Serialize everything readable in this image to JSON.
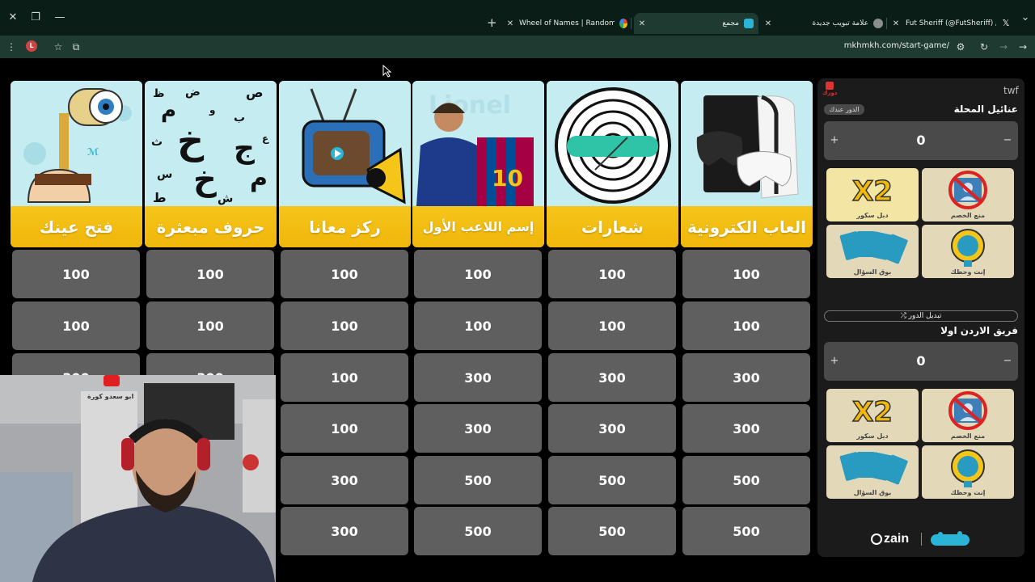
{
  "browser": {
    "tabs": [
      {
        "title": "Wheel of Names | Random nam",
        "fav_color": "#4285f4"
      },
      {
        "title": "مجمع",
        "fav_color": "#2ab5d6"
      },
      {
        "title": "علامة تبويب جديدة",
        "fav_color": "#aaaaaa"
      },
      {
        "title": "Fut Sheriff (@FutSheriff) / X",
        "fav_color": "#000000"
      }
    ],
    "profile_initial": "L",
    "url": "mkhmkh.com/start-game/"
  },
  "board": {
    "categories": [
      {
        "title": "العاب الكترونية"
      },
      {
        "title": "شعارات"
      },
      {
        "title": "إسم اللاعب الأول"
      },
      {
        "title": "ركز معانا"
      },
      {
        "title": "حروف مبعثرة"
      },
      {
        "title": "فتح عينك"
      }
    ],
    "columns": [
      [
        "100",
        "100",
        "300",
        "300",
        "500",
        "500"
      ],
      [
        "100",
        "100",
        "300",
        "300",
        "500",
        "500"
      ],
      [
        "100",
        "100",
        "300",
        "300",
        "500",
        "500"
      ],
      [
        "100",
        "100",
        "100",
        "100",
        "300",
        "300"
      ],
      [
        "100",
        "100",
        "300"
      ],
      [
        "100",
        "100",
        "300"
      ]
    ]
  },
  "panel": {
    "logo_text": "twf",
    "turn_word": "دورك",
    "team1": {
      "name": "عنائيل المحلة",
      "turn_badge": "الدور عندك",
      "score": "0"
    },
    "swap_label": "⤮ تبديل الدور",
    "team2": {
      "name": "فريق الاردن اولا",
      "score": "0"
    },
    "plus": "+",
    "minus": "−",
    "powerups": [
      {
        "label": "دبل سكور",
        "art": "X2"
      },
      {
        "label": "منع الخصم",
        "art": ""
      },
      {
        "label": "بوق السؤال",
        "art": ""
      },
      {
        "label": "إنت وحظك",
        "art": ""
      }
    ],
    "sponsor": "zain"
  },
  "webcam": {
    "sign_text": "ابو سعدو كورة"
  }
}
